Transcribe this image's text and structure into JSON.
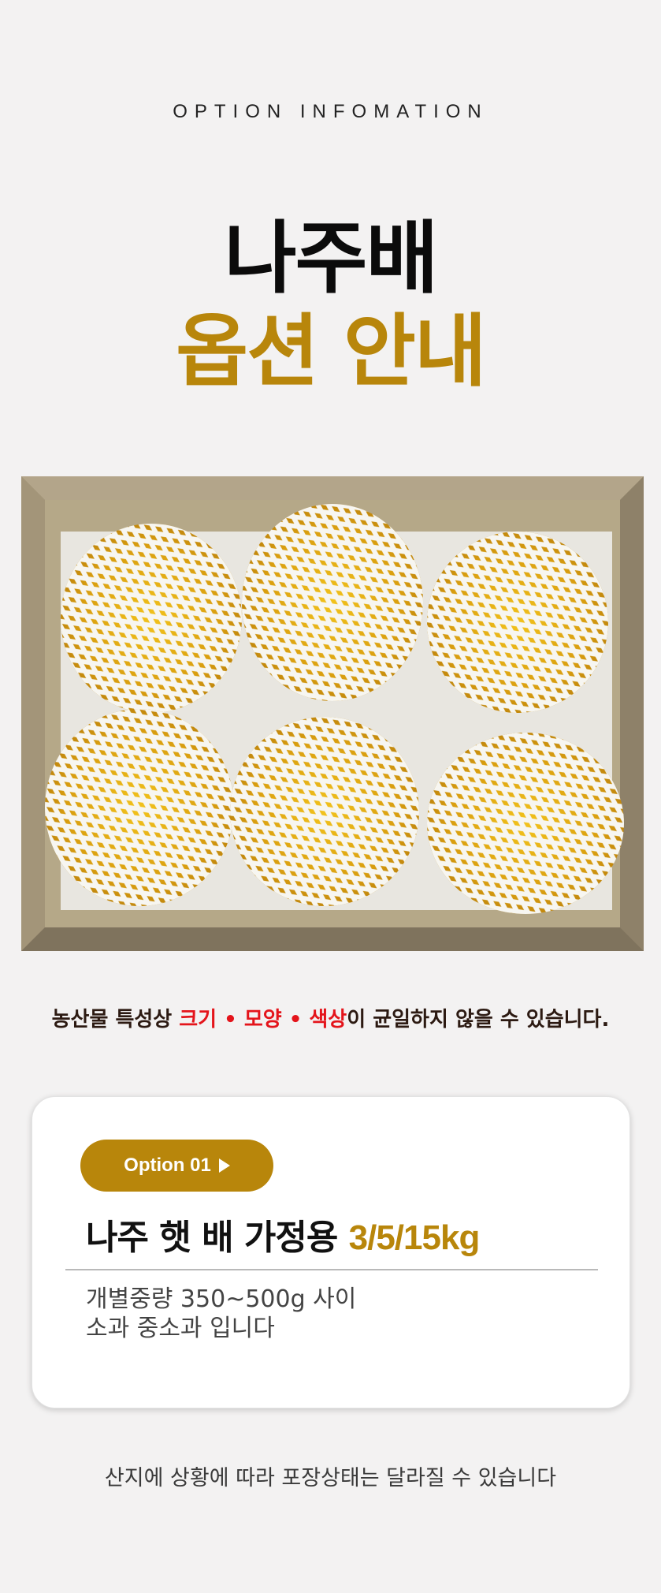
{
  "header": {
    "eyebrow": "OPTION INFOMATION",
    "title_line1": "나주배",
    "title_line2": "옵션 안내"
  },
  "photo": {
    "description_icon": "pears-in-box-photo"
  },
  "notice": {
    "prefix": "농산물 특성상 ",
    "highlight": "크기 • 모양 • 색상",
    "suffix": "이 균일하지 않을 수 있습니다."
  },
  "option": {
    "pill_label": "Option 01",
    "pill_icon": "play-triangle-icon",
    "name": "나주 햇 배 가정용 ",
    "amount": "3/5/15kg",
    "desc_line1": "개별중량 350~500g 사이",
    "desc_line2": "소과 중소과 입니다"
  },
  "footer": {
    "text": "산지에 상황에 따라 포장상태는 달라질 수 있습니다"
  },
  "colors": {
    "accent": "#b8860b",
    "highlight_red": "#e4141b",
    "background": "#f3f2f2"
  }
}
